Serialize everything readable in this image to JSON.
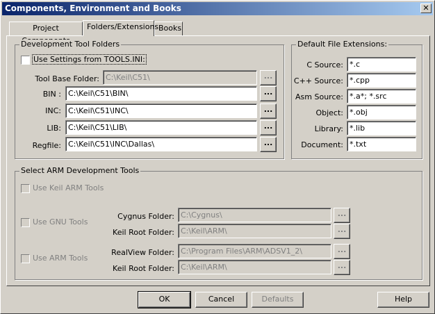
{
  "window": {
    "title": "Components, Environment and Books",
    "close_glyph": "✕"
  },
  "tabs": [
    {
      "label": "Project Components"
    },
    {
      "label": "Folders/Extensions"
    },
    {
      "label": "Books"
    }
  ],
  "dev_tool_folders": {
    "title": "Development Tool Folders",
    "use_settings_label": "Use Settings from TOOLS.INI:",
    "tool_base_label": "Tool Base Folder:",
    "tool_base_value": "C:\\Keil\\C51\\",
    "rows": [
      {
        "label": "BIN :",
        "value": "C:\\Keil\\C51\\BIN\\"
      },
      {
        "label": "INC:",
        "value": "C:\\Keil\\C51\\INC\\"
      },
      {
        "label": "LIB:",
        "value": "C:\\Keil\\C51\\LIB\\"
      },
      {
        "label": "Regfile:",
        "value": "C:\\Keil\\C51\\INC\\Dallas\\"
      }
    ],
    "browse_label": "..."
  },
  "default_extensions": {
    "title": "Default File Extensions:",
    "rows": [
      {
        "label": "C Source:",
        "value": "*.c"
      },
      {
        "label": "C++ Source:",
        "value": "*.cpp"
      },
      {
        "label": "Asm Source:",
        "value": "*.a*; *.src"
      },
      {
        "label": "Object:",
        "value": "*.obj"
      },
      {
        "label": "Library:",
        "value": "*.lib"
      },
      {
        "label": "Document:",
        "value": "*.txt"
      }
    ]
  },
  "arm_tools": {
    "title": "Select ARM Development Tools",
    "use_keil_label": "Use Keil ARM Tools",
    "use_gnu_label": "Use GNU Tools",
    "cygnus_label": "Cygnus Folder:",
    "cygnus_value": "C:\\Cygnus\\",
    "keil_root_label": "Keil Root Folder:",
    "gnu_keil_root_value": "C:\\Keil\\ARM\\",
    "use_arm_label": "Use ARM Tools",
    "realview_label": "RealView Folder:",
    "realview_value": "C:\\Program Files\\ARM\\ADSV1_2\\",
    "arm_keil_root_value": "C:\\Keil\\ARM\\"
  },
  "buttons": {
    "ok": "OK",
    "cancel": "Cancel",
    "defaults": "Defaults",
    "help": "Help"
  }
}
